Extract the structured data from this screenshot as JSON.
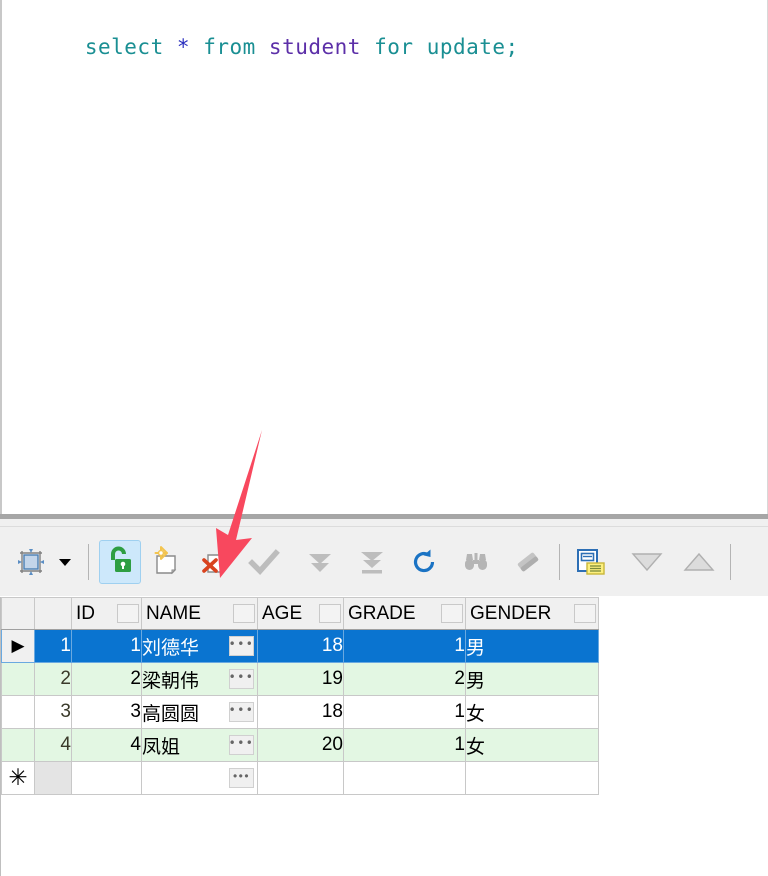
{
  "editor": {
    "sql_tokens": [
      {
        "t": "select",
        "cls": "kw"
      },
      {
        "t": " ",
        "cls": "plain"
      },
      {
        "t": "*",
        "cls": "star"
      },
      {
        "t": " ",
        "cls": "plain"
      },
      {
        "t": "from",
        "cls": "kw"
      },
      {
        "t": " ",
        "cls": "plain"
      },
      {
        "t": "student",
        "cls": "ident"
      },
      {
        "t": " ",
        "cls": "plain"
      },
      {
        "t": "for",
        "cls": "kw"
      },
      {
        "t": " ",
        "cls": "plain"
      },
      {
        "t": "update",
        "cls": "kw"
      },
      {
        "t": ";",
        "cls": "punc"
      }
    ],
    "sql_text": "select * from student for update;"
  },
  "annotation": {
    "arrow_color": "#f8485e",
    "points_to": "delete-record-button"
  },
  "toolbar": {
    "items": [
      {
        "name": "select-mode-button",
        "icon": "select-frame-icon",
        "label": "",
        "state": "normal"
      },
      {
        "name": "select-mode-dropdown",
        "icon": "chevron-down-icon",
        "label": "",
        "state": "normal"
      },
      {
        "name": "lock-toggle-button",
        "icon": "unlock-icon",
        "label": "",
        "state": "active"
      },
      {
        "name": "new-record-button",
        "icon": "new-record-icon",
        "label": "",
        "state": "normal"
      },
      {
        "name": "delete-record-button",
        "icon": "delete-record-icon",
        "label": "",
        "state": "normal"
      },
      {
        "name": "commit-button",
        "icon": "checkmark-icon",
        "label": "",
        "state": "disabled"
      },
      {
        "name": "next-page-button",
        "icon": "double-down-arrow-icon",
        "label": "",
        "state": "disabled"
      },
      {
        "name": "last-page-button",
        "icon": "down-arrow-to-bar-icon",
        "label": "",
        "state": "disabled"
      },
      {
        "name": "refresh-button",
        "icon": "refresh-icon",
        "label": "",
        "state": "normal"
      },
      {
        "name": "find-button",
        "icon": "binoculars-icon",
        "label": "",
        "state": "normal"
      },
      {
        "name": "clear-filter-button",
        "icon": "eraser-icon",
        "label": "",
        "state": "normal"
      },
      {
        "name": "form-view-button",
        "icon": "form-grid-icon",
        "label": "",
        "state": "normal"
      },
      {
        "name": "collapse-button",
        "icon": "triangle-down-icon",
        "label": "",
        "state": "disabled"
      },
      {
        "name": "expand-button",
        "icon": "triangle-up-icon",
        "label": "",
        "state": "disabled"
      }
    ],
    "accent_active_bg": "#cde8fb",
    "lock_color": "#2e9e42",
    "delete_x_color": "#d9431f",
    "refresh_color": "#1a73c4"
  },
  "grid": {
    "columns": [
      "ID",
      "NAME",
      "AGE",
      "GRADE",
      "GENDER"
    ],
    "selected_row_index": 0,
    "selected_color": "#0a74d0",
    "alt_row_color": "#e3f7e3",
    "rows": [
      {
        "num": "1",
        "ID": "1",
        "NAME": "刘德华",
        "AGE": "18",
        "GRADE": "1",
        "GENDER": "男"
      },
      {
        "num": "2",
        "ID": "2",
        "NAME": "梁朝伟",
        "AGE": "19",
        "GRADE": "2",
        "GENDER": "男"
      },
      {
        "num": "3",
        "ID": "3",
        "NAME": "高圆圆",
        "AGE": "18",
        "GRADE": "1",
        "GENDER": "女"
      },
      {
        "num": "4",
        "ID": "4",
        "NAME": "凤姐",
        "AGE": "20",
        "GRADE": "1",
        "GENDER": "女"
      }
    ],
    "new_row_marker": "✳",
    "current_row_marker": "▶",
    "ellipsis_label": "•••"
  }
}
